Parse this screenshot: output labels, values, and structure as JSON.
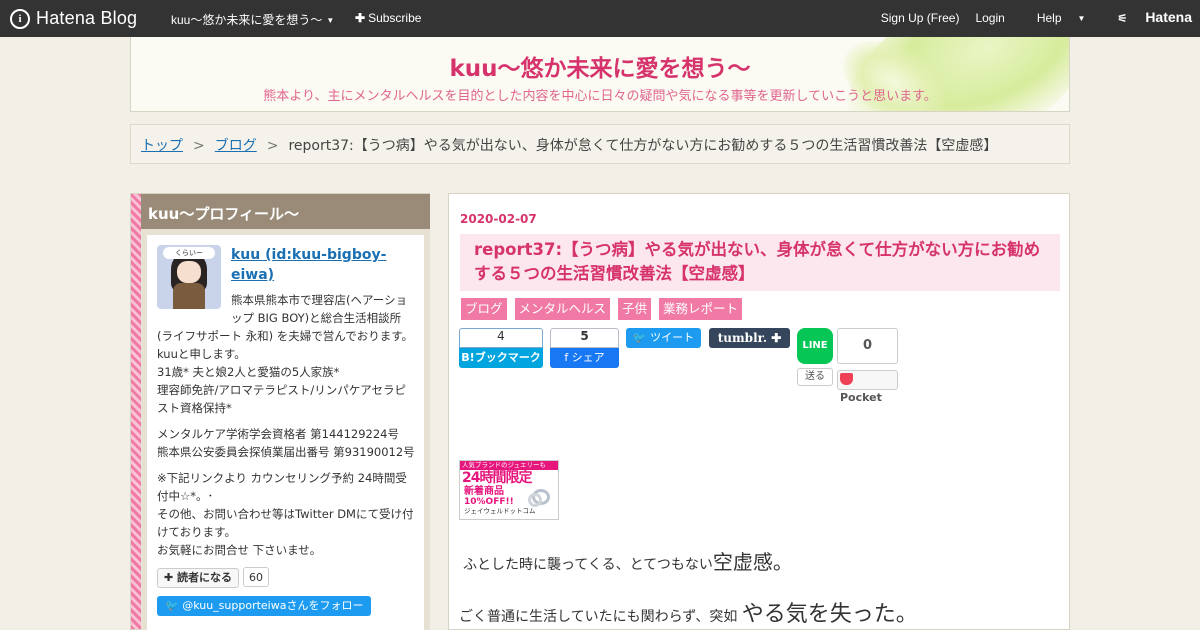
{
  "globalheader": {
    "logo_mark": "i",
    "logo_text": "Hatena Blog",
    "blog_title": "kuu～悠か未来に愛を想う～",
    "subscribe_label": "Subscribe",
    "signup_label": "Sign Up (Free)",
    "login_label": "Login",
    "help_label": "Help",
    "hatena_label": "Hatena"
  },
  "blog_header": {
    "title": "kuu～悠か未来に愛を想う～",
    "description": "熊本より、主にメンタルヘルスを目的とした内容を中心に日々の疑問や気になる事等を更新していこうと思います。"
  },
  "breadcrumb": {
    "items": [
      "トップ",
      "ブログ"
    ],
    "separator": ">",
    "current": "report37:【うつ病】やる気が出ない、身体が怠くて仕方がない方にお勧めする５つの生活習慣改善法【空虚感】"
  },
  "sidebar": {
    "title": "kuu～プロフィール～",
    "avatar_text": "くらいー",
    "profile_name": "kuu (id:kuu-bigboy-eiwa)",
    "bio_1": "熊本県熊本市で理容店(ヘアーショップ BIG BOY)と総合生活相談所(ライフサポート 永和) を夫婦で営んでおります。",
    "bio_2": "kuuと申します。",
    "bio_3": "31歳* 夫と娘2人と愛猫の5人家族*",
    "bio_4": "理容師免許/アロマテラピスト/リンパケアセラピスト資格保持*",
    "cert_1": "メンタルケア学術学会資格者 第144129224号",
    "cert_2": "熊本県公安委員会探偵業届出番号 第93190012号",
    "note_1": "※下記リンクより カウンセリング予約 24時間受付中☆*。･",
    "note_2": "その他、お問い合わせ等はTwitter DMにて受け付けております。",
    "note_3": "お気軽にお問合せ 下さいませ。",
    "follow_label": "読者になる",
    "follow_count": "60",
    "twitter_follow_label": "@kuu_supporteiwaさんをフォロー"
  },
  "entry": {
    "date": "2020-02-07",
    "title": "report37:【うつ病】やる気が出ない、身体が怠くて仕方がない方にお勧めする５つの生活習慣改善法【空虚感】",
    "categories": [
      "ブログ",
      "メンタルヘルス",
      "子供",
      "業務レポート"
    ],
    "share": {
      "hatebu_count": "4",
      "hatebu_label": "B!ブックマーク",
      "fb_count": "5",
      "fb_label": "f シェア",
      "tweet_label": "ツイート",
      "tumblr_label": "tumblr.",
      "line_label": "LINE",
      "line_send_label": "送る",
      "pocket_count": "0",
      "pocket_label": "Pocket"
    },
    "ad": {
      "line1": "人気ブランドのジュエリーも",
      "line2": "24時間限定",
      "line3": "新着商品",
      "line4": "10%OFF!!",
      "line5": "ジェイウェルドットコム"
    },
    "body_1_small": "ふとした時に襲ってくる、とてつもない",
    "body_1_big": "空虚感。",
    "body_2_small": "ごく普通に生活していたにも関わらず、突如",
    "body_2_big": "やる気を失った。"
  },
  "colors": {
    "accent_pink": "#d6336c",
    "category_pink": "#f07aa5",
    "header_dark": "#333333",
    "link_blue": "#1b6fb3"
  }
}
